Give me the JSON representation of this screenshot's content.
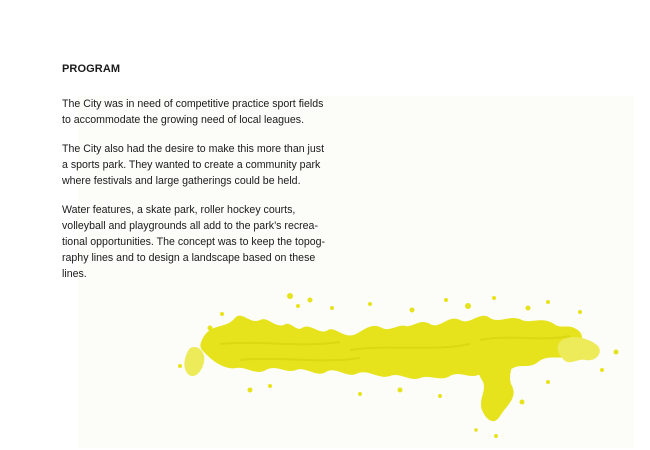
{
  "heading": "PROGRAM",
  "paragraphs": [
    {
      "lines": [
        "The City was in need of competitive practice sport fields",
        "to accommodate the growing need of local leagues."
      ]
    },
    {
      "lines": [
        "The City also had the desire to make this more than just",
        "a sports park. They wanted to create a community park",
        "where festivals and large gatherings could be held."
      ]
    },
    {
      "lines": [
        "Water features, a skate park, roller hockey courts,",
        "volleyball and playgrounds all add to the park’s recrea-",
        "tional opportunities. The concept was to keep the topog-",
        "raphy lines and to design a landscape based on these",
        "lines."
      ]
    }
  ],
  "colors": {
    "paint": "#e6e31c",
    "paint_light": "#eeeb5a",
    "text": "#1a1a1a",
    "art_background": "#fcfcf8"
  }
}
